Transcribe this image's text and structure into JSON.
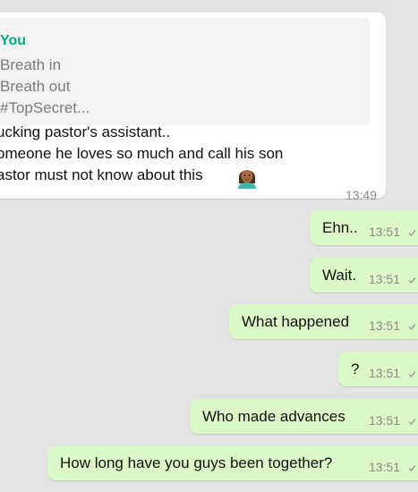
{
  "incoming": {
    "quote": {
      "sender": "You",
      "lines": [
        "Breath in",
        "Breath out",
        "#TopSecret..."
      ]
    },
    "lines": [
      "ucking pastor's assistant..",
      "omeone he loves so much and call his son",
      "astor must not know about this"
    ],
    "emoji": "woman-medium-dark-skin-tone-emoji",
    "time": "13:49"
  },
  "outgoing": [
    {
      "text": "Ehn..",
      "time": "13:51",
      "status": "sent-tick"
    },
    {
      "text": "Wait.",
      "time": "13:51",
      "status": "sent-tick"
    },
    {
      "text": "What happened",
      "time": "13:51",
      "status": "sent-tick"
    },
    {
      "text": "?",
      "time": "13:51",
      "status": "sent-tick"
    },
    {
      "text": "Who made advances",
      "time": "13:51",
      "status": "sent-tick"
    },
    {
      "text": "How long have you guys been together?",
      "time": "13:51",
      "status": "sent-tick"
    }
  ],
  "colors": {
    "background": "#e3e3e3",
    "incoming_bubble": "#ffffff",
    "outgoing_bubble": "#dcf8c6",
    "accent": "#00a884"
  }
}
